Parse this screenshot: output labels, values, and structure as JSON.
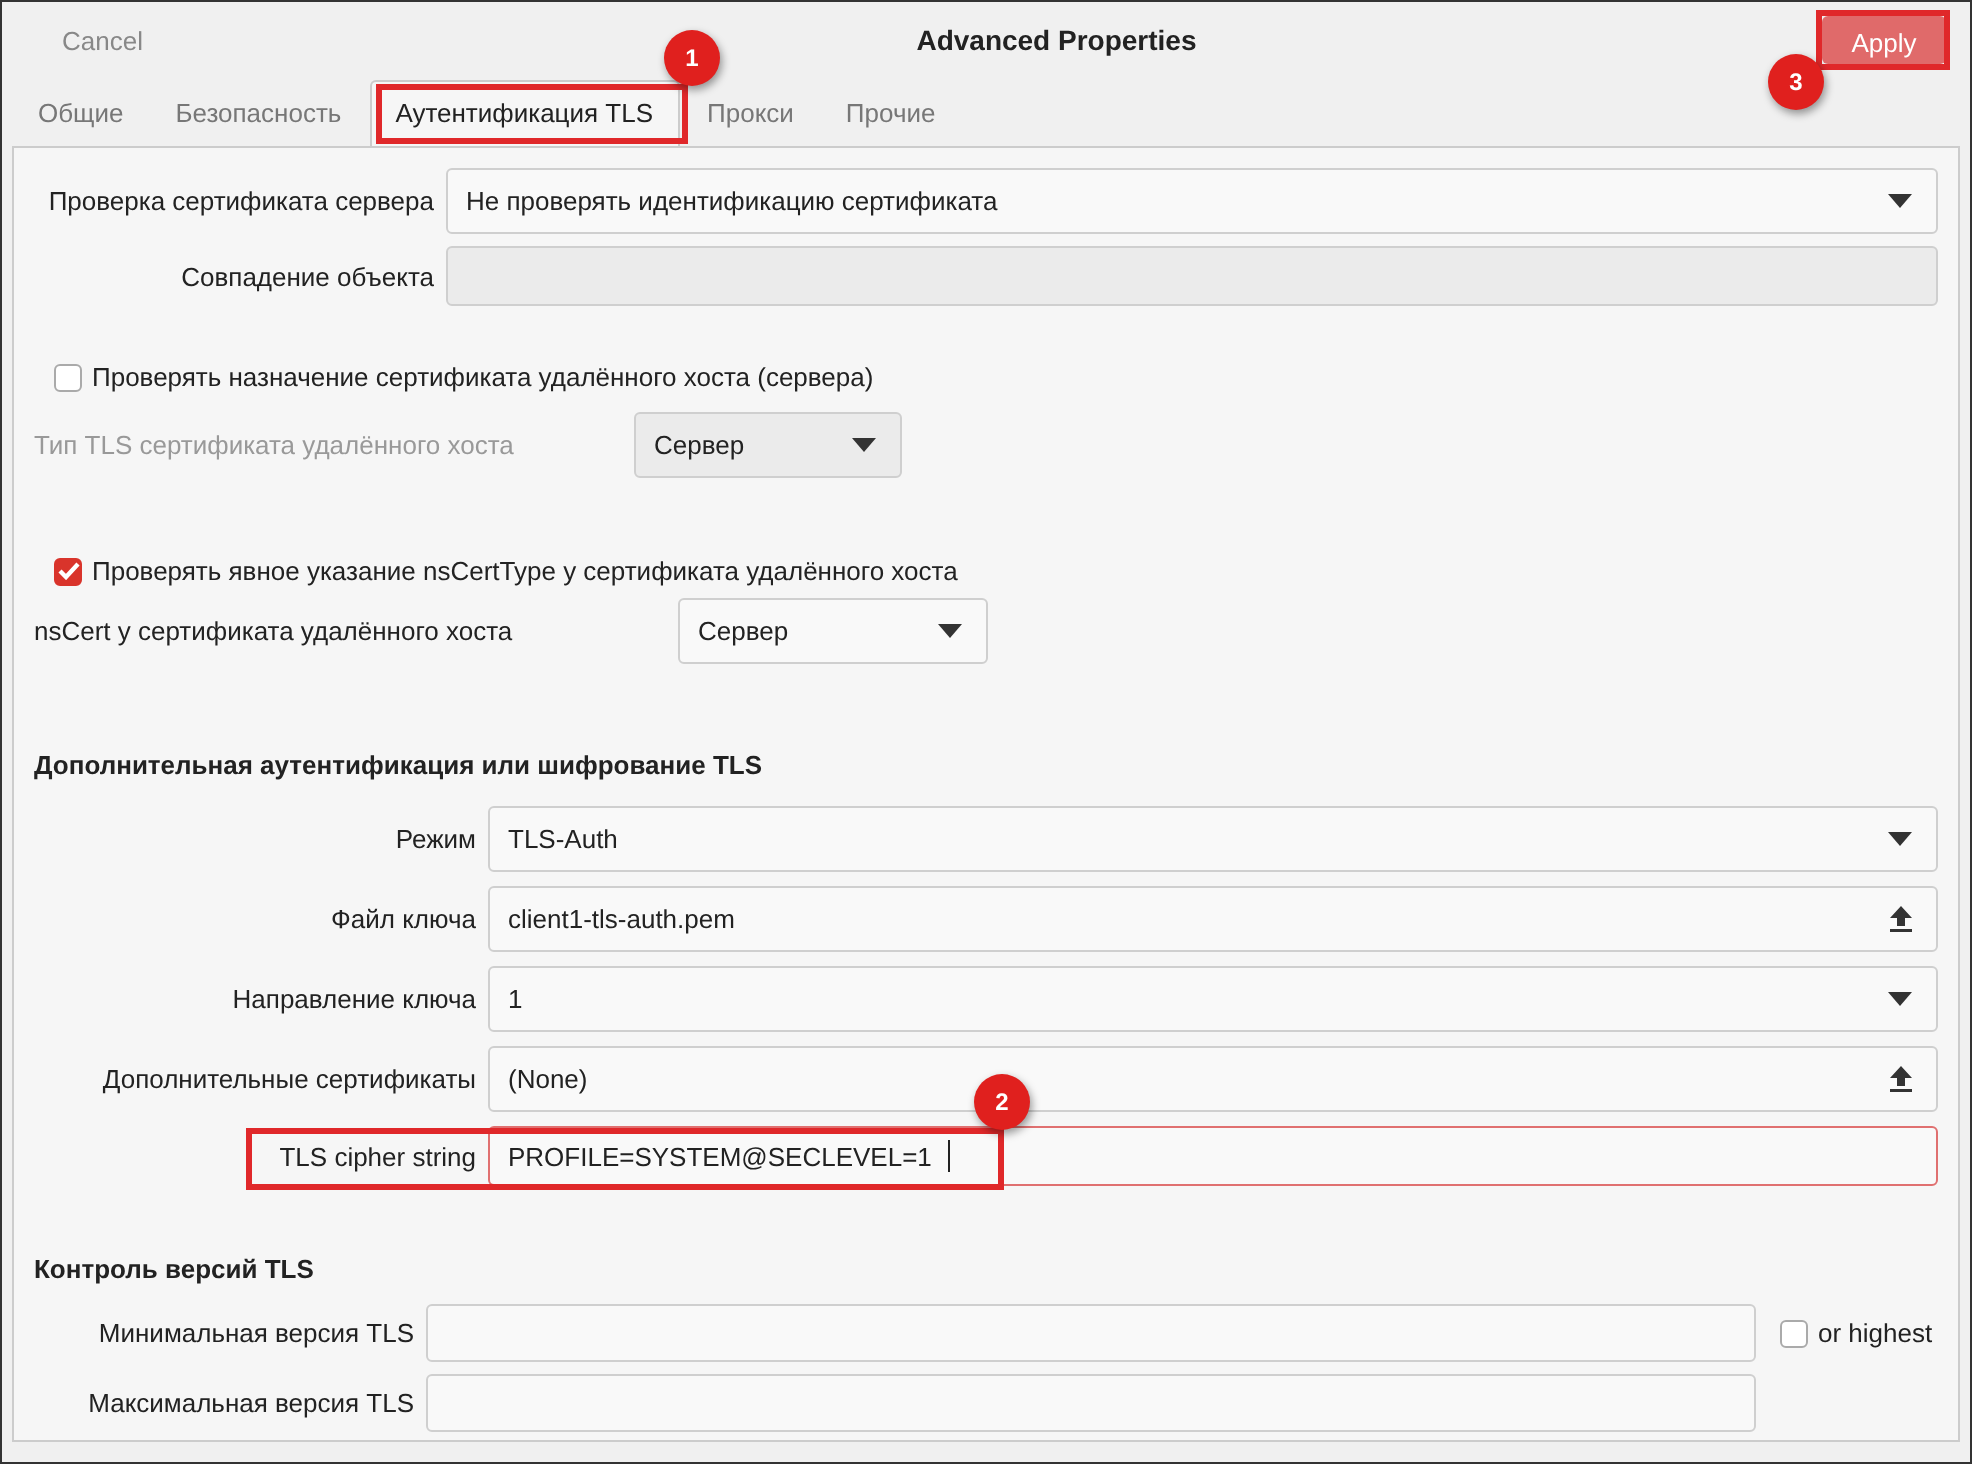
{
  "window": {
    "cancel": "Cancel",
    "title": "Advanced Properties",
    "apply": "Apply"
  },
  "tabs": [
    {
      "label": "Общие",
      "selected": false
    },
    {
      "label": "Безопасность",
      "selected": false
    },
    {
      "label": "Аутентификация TLS",
      "selected": true
    },
    {
      "label": "Прокси",
      "selected": false
    },
    {
      "label": "Прочие",
      "selected": false
    }
  ],
  "server_check": {
    "label": "Проверка сертификата сервера",
    "value": "Не проверять идентификацию сертификата"
  },
  "subject_match": {
    "label": "Совпадение объекта",
    "disabled": true
  },
  "remote_usage": {
    "label": "Проверять назначение сертификата удалённого хоста (сервера)",
    "checked": false,
    "type_label": "Тип TLS сертификата удалённого хоста",
    "type_value": "Сервер",
    "disabled": true
  },
  "ns_cert": {
    "label": "Проверять явное указание nsCertType у сертификата удалённого хоста",
    "checked": true,
    "type_label": "nsCert у сертификата удалённого хоста",
    "type_value": "Сервер",
    "disabled": false
  },
  "auth": {
    "heading": "Дополнительная аутентификация или шифрование TLS",
    "fields": [
      {
        "label": "Режим",
        "value": "TLS-Auth",
        "kind": "dropdown",
        "invalid": false,
        "focused": false
      },
      {
        "label": "Файл ключа",
        "value": "client1-tls-auth.pem",
        "kind": "file",
        "invalid": false,
        "focused": false
      },
      {
        "label": "Направление ключа",
        "value": "1",
        "kind": "dropdown",
        "invalid": false,
        "focused": false
      },
      {
        "label": "Дополнительные сертификаты",
        "value": "(None)",
        "kind": "file",
        "invalid": false,
        "focused": false
      },
      {
        "label": "TLS cipher string",
        "value": "PROFILE=SYSTEM@SECLEVEL=1",
        "kind": "text",
        "invalid": true,
        "focused": true
      }
    ]
  },
  "versions": {
    "heading": "Контроль версий TLS",
    "fields": [
      {
        "label": "Минимальная версия TLS"
      },
      {
        "label": "Максимальная версия TLS"
      }
    ],
    "or_highest": {
      "label": "or highest",
      "checked": false
    }
  },
  "annotations": [
    {
      "number": "1"
    },
    {
      "number": "2"
    },
    {
      "number": "3"
    }
  ]
}
